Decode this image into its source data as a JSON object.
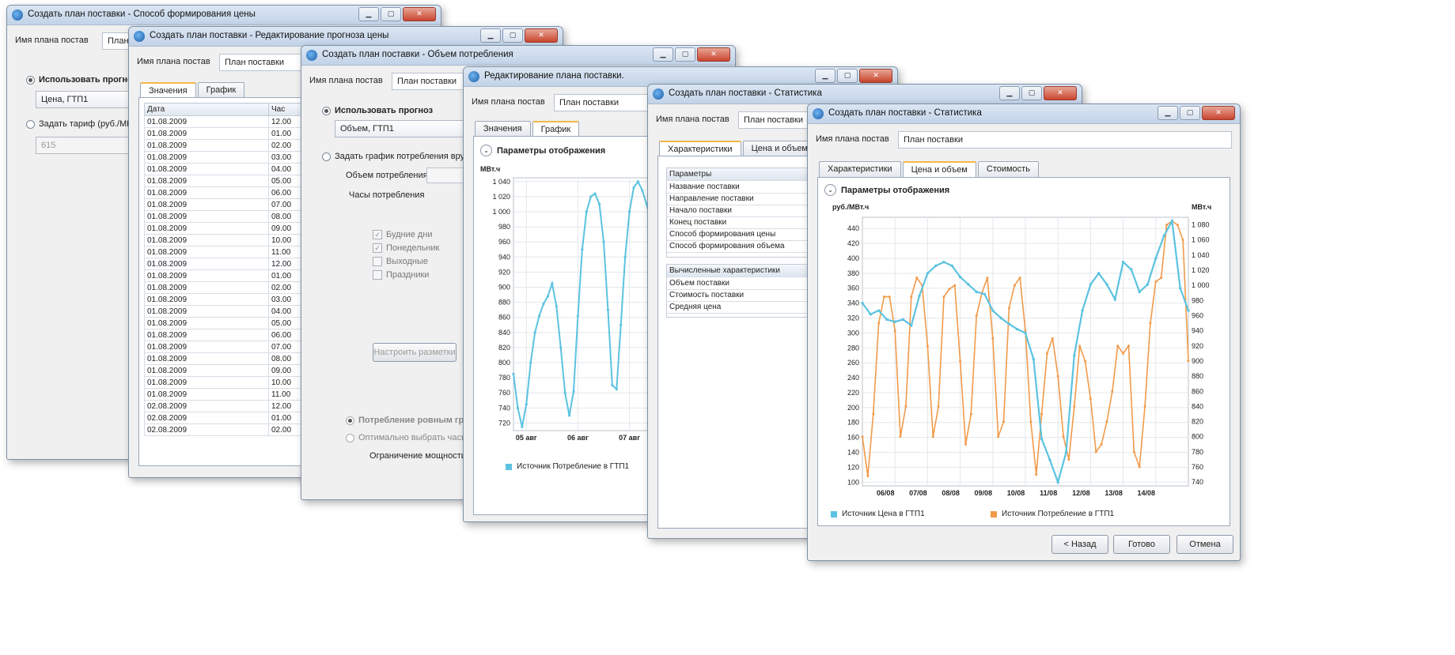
{
  "colors": {
    "blue_series": "#5bc3e0",
    "orange_series": "#f29a4a",
    "accent_tab": "#f4b74a"
  },
  "win1": {
    "title": "Создать план поставки - Способ формирования цены",
    "name_label": "Имя плана постав",
    "name_value": "План п",
    "use_forecast": "Использовать прогноз",
    "forecast_combo": "Цена, ГТП1",
    "set_tariff": "Задать тариф (руб./МВт",
    "tariff_value": "615"
  },
  "win2": {
    "title": "Создать план поставки - Редактирование прогноза цены",
    "name_label": "Имя плана постав",
    "name_value": "План поставки",
    "tabs": [
      "Значения",
      "График"
    ],
    "col_date": "Дата",
    "col_hour": "Час",
    "rows": [
      [
        "01.08.2009",
        "12.00"
      ],
      [
        "01.08.2009",
        "01.00"
      ],
      [
        "01.08.2009",
        "02.00"
      ],
      [
        "01.08.2009",
        "03.00"
      ],
      [
        "01.08.2009",
        "04.00"
      ],
      [
        "01.08.2009",
        "05.00"
      ],
      [
        "01.08.2009",
        "06.00"
      ],
      [
        "01.08.2009",
        "07.00"
      ],
      [
        "01.08.2009",
        "08.00"
      ],
      [
        "01.08.2009",
        "09.00"
      ],
      [
        "01.08.2009",
        "10.00"
      ],
      [
        "01.08.2009",
        "11.00"
      ],
      [
        "01.08.2009",
        "12.00"
      ],
      [
        "01.08.2009",
        "01.00"
      ],
      [
        "01.08.2009",
        "02.00"
      ],
      [
        "01.08.2009",
        "03.00"
      ],
      [
        "01.08.2009",
        "04.00"
      ],
      [
        "01.08.2009",
        "05.00"
      ],
      [
        "01.08.2009",
        "06.00"
      ],
      [
        "01.08.2009",
        "07.00"
      ],
      [
        "01.08.2009",
        "08.00"
      ],
      [
        "01.08.2009",
        "09.00"
      ],
      [
        "01.08.2009",
        "10.00"
      ],
      [
        "01.08.2009",
        "11.00"
      ],
      [
        "02.08.2009",
        "12.00"
      ],
      [
        "02.08.2009",
        "01.00"
      ],
      [
        "02.08.2009",
        "02.00"
      ]
    ]
  },
  "win3": {
    "title": "Создать план поставки - Объем потребления",
    "name_label": "Имя плана постав",
    "name_value": "План поставки",
    "use_forecast": "Использовать прогноз",
    "forecast_combo": "Объем, ГТП1",
    "manual": "Задать график потребления вручн",
    "volume_label": "Объем потребления",
    "hours_label": "Часы потребления",
    "checks": [
      "Будние дни",
      "Понедельник",
      "Выходные",
      "Праздники"
    ],
    "checks_state": [
      true,
      true,
      false,
      false
    ],
    "configure_btn": "Настроить разметки",
    "even_consumption": "Потребление ровным гра",
    "optimal_hours": "Оптимально выбрать часы",
    "power_limit": "Ограничение мощности"
  },
  "win4": {
    "title": "Редактирование плана поставки.",
    "name_label": "Имя плана постав",
    "name_value": "План поставки",
    "tabs": [
      "Значения",
      "График"
    ],
    "section": "Параметры отображения",
    "legend": "Источник Потребление в ГТП1"
  },
  "win5": {
    "title": "Создать план поставки - Статистика",
    "name_label": "Имя плана постав",
    "name_value": "План поставки",
    "tabs": [
      "Характеристики",
      "Цена и объем"
    ],
    "params_header": "Параметры",
    "params": [
      "Название поставки",
      "Направление поставки",
      "Начало поставки",
      "Конец поставки",
      "Способ формирования цены",
      "Способ формирования объема"
    ],
    "computed_header": "Вычисленные характеристики",
    "computed": [
      "Объем поставки",
      "Стоимость поставки",
      "Средняя цена"
    ]
  },
  "win6": {
    "title": "Создать план поставки - Статистика",
    "name_label": "Имя плана постав",
    "name_value": "План поставки",
    "tabs": [
      "Характеристики",
      "Цена и объем",
      "Стоимость"
    ],
    "section": "Параметры отображения",
    "btn_back": "< Назад",
    "btn_done": "Готово",
    "btn_cancel": "Отмена"
  },
  "chart_data": [
    {
      "type": "line",
      "ylabel": "МВт.ч",
      "ylim": [
        710,
        1045
      ],
      "yticks": [
        720,
        740,
        760,
        780,
        800,
        820,
        840,
        860,
        880,
        900,
        920,
        940,
        960,
        980,
        1000,
        1020,
        1040
      ],
      "ytick_labels": [
        "720",
        "740",
        "760",
        "780",
        "800",
        "820",
        "840",
        "860",
        "880",
        "900",
        "920",
        "940",
        "960",
        "980",
        "1 000",
        "1 020",
        "1 040"
      ],
      "xticks": [
        6,
        30,
        54
      ],
      "xtick_labels": [
        "05 авг",
        "06 авг",
        "07 авг"
      ],
      "xlim": [
        0,
        70
      ],
      "grid": true,
      "legend_position": "bottom",
      "series": [
        {
          "name": "Источник Потребление в ГТП1",
          "x": [
            0,
            2,
            4,
            6,
            8,
            10,
            12,
            14,
            16,
            18,
            20,
            22,
            24,
            26,
            28,
            30,
            32,
            34,
            36,
            38,
            40,
            42,
            44,
            46,
            48,
            50,
            52,
            54,
            56,
            58,
            60,
            62,
            64,
            66,
            68,
            70
          ],
          "values": [
            785,
            740,
            715,
            745,
            800,
            840,
            862,
            878,
            888,
            905,
            875,
            820,
            760,
            730,
            762,
            862,
            950,
            1000,
            1020,
            1024,
            1010,
            960,
            870,
            770,
            765,
            850,
            940,
            1000,
            1032,
            1040,
            1028,
            1010,
            985,
            965,
            950,
            945
          ]
        }
      ]
    },
    {
      "type": "line",
      "ylabel_left": "руб./МВт.ч",
      "ylabel_right": "МВт.ч",
      "ylim_left": [
        95,
        455
      ],
      "yticks_left": [
        100,
        120,
        140,
        160,
        180,
        200,
        220,
        240,
        260,
        280,
        300,
        320,
        340,
        360,
        380,
        400,
        420,
        440
      ],
      "ylim_right": [
        735,
        1090
      ],
      "yticks_right": [
        740,
        760,
        780,
        800,
        820,
        840,
        860,
        880,
        900,
        920,
        940,
        960,
        980,
        1000,
        1020,
        1040,
        1060,
        1080
      ],
      "ytick_labels_right": [
        "740",
        "760",
        "780",
        "800",
        "820",
        "840",
        "860",
        "880",
        "900",
        "920",
        "940",
        "960",
        "980",
        "1 000",
        "1 020",
        "1 040",
        "1 060",
        "1 080"
      ],
      "xticks": [
        24,
        48,
        72,
        96,
        120,
        144,
        168,
        192,
        216
      ],
      "xtick_labels": [
        "06/08",
        "07/08",
        "08/08",
        "09/08",
        "10/08",
        "11/08",
        "12/08",
        "13/08",
        "14/08"
      ],
      "xlim": [
        0,
        240
      ],
      "grid": true,
      "legend_position": "bottom",
      "series": [
        {
          "name": "Источник Цена в ГТП1",
          "axis": "left",
          "x": [
            0,
            6,
            12,
            18,
            24,
            30,
            36,
            42,
            48,
            54,
            60,
            66,
            72,
            78,
            84,
            90,
            96,
            102,
            108,
            114,
            120,
            126,
            132,
            138,
            144,
            150,
            156,
            162,
            168,
            174,
            180,
            186,
            192,
            198,
            204,
            210,
            216,
            222,
            228,
            234,
            240
          ],
          "values": [
            340,
            325,
            330,
            318,
            315,
            318,
            310,
            350,
            380,
            390,
            395,
            390,
            375,
            365,
            355,
            352,
            330,
            320,
            312,
            305,
            300,
            265,
            158,
            130,
            100,
            140,
            270,
            330,
            365,
            380,
            365,
            345,
            395,
            385,
            355,
            365,
            400,
            430,
            450,
            360,
            330
          ]
        },
        {
          "name": "Источник Потребление в ГТП1",
          "axis": "right",
          "x": [
            0,
            4,
            8,
            12,
            16,
            20,
            24,
            28,
            32,
            36,
            40,
            44,
            48,
            52,
            56,
            60,
            64,
            68,
            72,
            76,
            80,
            84,
            88,
            92,
            96,
            100,
            104,
            108,
            112,
            116,
            120,
            124,
            128,
            132,
            136,
            140,
            144,
            148,
            152,
            156,
            160,
            164,
            168,
            172,
            176,
            180,
            184,
            188,
            192,
            196,
            200,
            204,
            208,
            212,
            216,
            220,
            224,
            228,
            232,
            236,
            240
          ],
          "values": [
            800,
            748,
            830,
            950,
            985,
            985,
            940,
            800,
            840,
            985,
            1010,
            1000,
            920,
            800,
            840,
            985,
            995,
            1000,
            900,
            790,
            830,
            960,
            990,
            1010,
            930,
            800,
            820,
            970,
            1000,
            1010,
            940,
            820,
            750,
            830,
            910,
            930,
            880,
            800,
            770,
            840,
            920,
            900,
            850,
            780,
            790,
            820,
            860,
            920,
            910,
            920,
            780,
            760,
            840,
            950,
            1005,
            1010,
            1080,
            1085,
            1080,
            1060,
            900
          ]
        }
      ]
    }
  ]
}
